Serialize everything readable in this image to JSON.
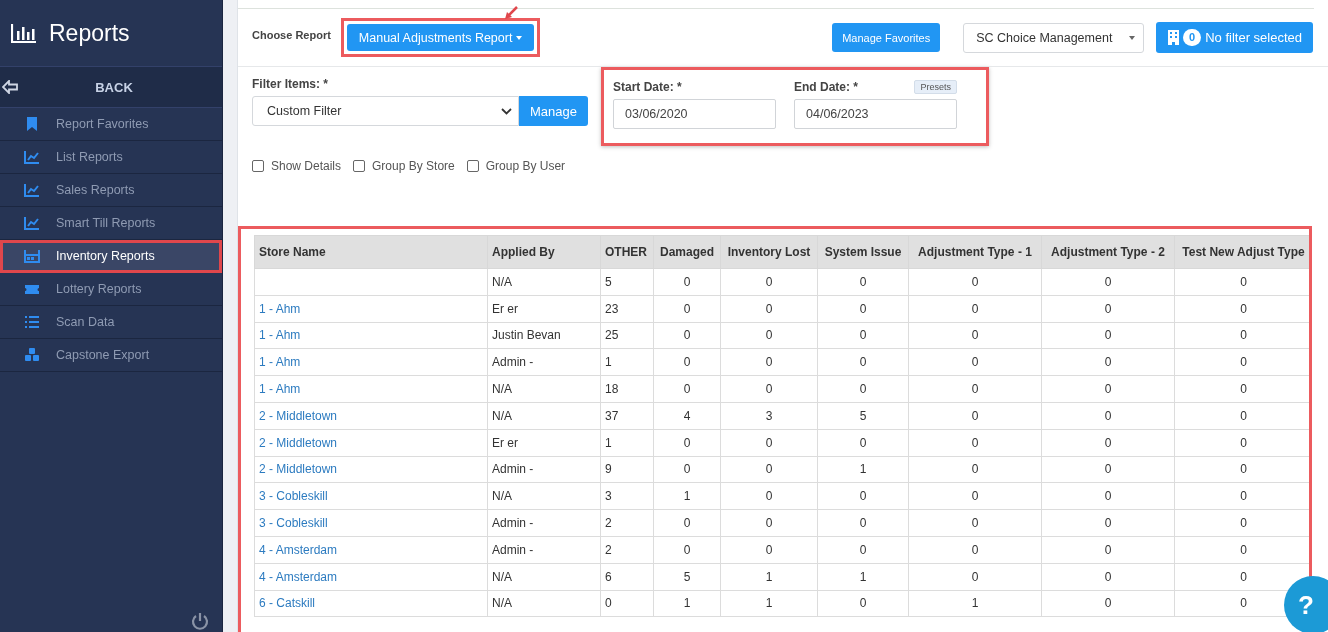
{
  "sidebar": {
    "title": "Reports",
    "back": "BACK",
    "items": [
      {
        "label": "Report Favorites",
        "selected": false,
        "highlighted": false
      },
      {
        "label": "List Reports",
        "selected": false,
        "highlighted": false
      },
      {
        "label": "Sales Reports",
        "selected": false,
        "highlighted": false
      },
      {
        "label": "Smart Till Reports",
        "selected": false,
        "highlighted": false
      },
      {
        "label": "Inventory Reports",
        "selected": true,
        "highlighted": true
      },
      {
        "label": "Lottery Reports",
        "selected": false,
        "highlighted": false
      },
      {
        "label": "Scan Data",
        "selected": false,
        "highlighted": false
      },
      {
        "label": "Capstone Export",
        "selected": false,
        "highlighted": false
      }
    ]
  },
  "toolbar": {
    "choose_label": "Choose Report",
    "report_button": {
      "label": "Manual Adjustments Report",
      "highlighted": true
    },
    "favorites_button": "Manage Favorites",
    "company_select": "SC Choice Management",
    "filter_count": "0",
    "filter_button": "No filter selected"
  },
  "filters": {
    "filter_label": "Filter Items: *",
    "filter_select": "Custom Filter",
    "manage_button": "Manage",
    "dates_highlighted": true,
    "start_label": "Start Date: *",
    "start_value": "03/06/2020",
    "end_label": "End Date: *",
    "presets": "Presets",
    "end_value": "04/06/2023",
    "options": [
      {
        "label": "Show Details",
        "checked": false
      },
      {
        "label": "Group By Store",
        "checked": false
      },
      {
        "label": "Group By User",
        "checked": false
      }
    ]
  },
  "table": {
    "highlighted": true,
    "columns": [
      "Store Name",
      "Applied By",
      "OTHER",
      "Damaged",
      "Inventory Lost",
      "System Issue",
      "Adjustment Type - 1",
      "Adjustment Type - 2",
      "Test New Adjust Type"
    ],
    "rows": [
      [
        "",
        "N/A",
        "5",
        "0",
        "0",
        "0",
        "0",
        "0",
        "0"
      ],
      [
        "1 - Ahm",
        "Er er",
        "23",
        "0",
        "0",
        "0",
        "0",
        "0",
        "0"
      ],
      [
        "1 - Ahm",
        "Justin Bevan",
        "25",
        "0",
        "0",
        "0",
        "0",
        "0",
        "0"
      ],
      [
        "1 - Ahm",
        "Admin -",
        "1",
        "0",
        "0",
        "0",
        "0",
        "0",
        "0"
      ],
      [
        "1 - Ahm",
        "N/A",
        "18",
        "0",
        "0",
        "0",
        "0",
        "0",
        "0"
      ],
      [
        "2 - Middletown",
        "N/A",
        "37",
        "4",
        "3",
        "5",
        "0",
        "0",
        "0"
      ],
      [
        "2 - Middletown",
        "Er er",
        "1",
        "0",
        "0",
        "0",
        "0",
        "0",
        "0"
      ],
      [
        "2 - Middletown",
        "Admin -",
        "9",
        "0",
        "0",
        "1",
        "0",
        "0",
        "0"
      ],
      [
        "3 - Cobleskill",
        "N/A",
        "3",
        "1",
        "0",
        "0",
        "0",
        "0",
        "0"
      ],
      [
        "3 - Cobleskill",
        "Admin -",
        "2",
        "0",
        "0",
        "0",
        "0",
        "0",
        "0"
      ],
      [
        "4 - Amsterdam",
        "Admin -",
        "2",
        "0",
        "0",
        "0",
        "0",
        "0",
        "0"
      ],
      [
        "4 - Amsterdam",
        "N/A",
        "6",
        "5",
        "1",
        "1",
        "0",
        "0",
        "0"
      ],
      [
        "6 - Catskill",
        "N/A",
        "0",
        "1",
        "1",
        "0",
        "1",
        "0",
        "0"
      ]
    ]
  },
  "help_button": "?"
}
